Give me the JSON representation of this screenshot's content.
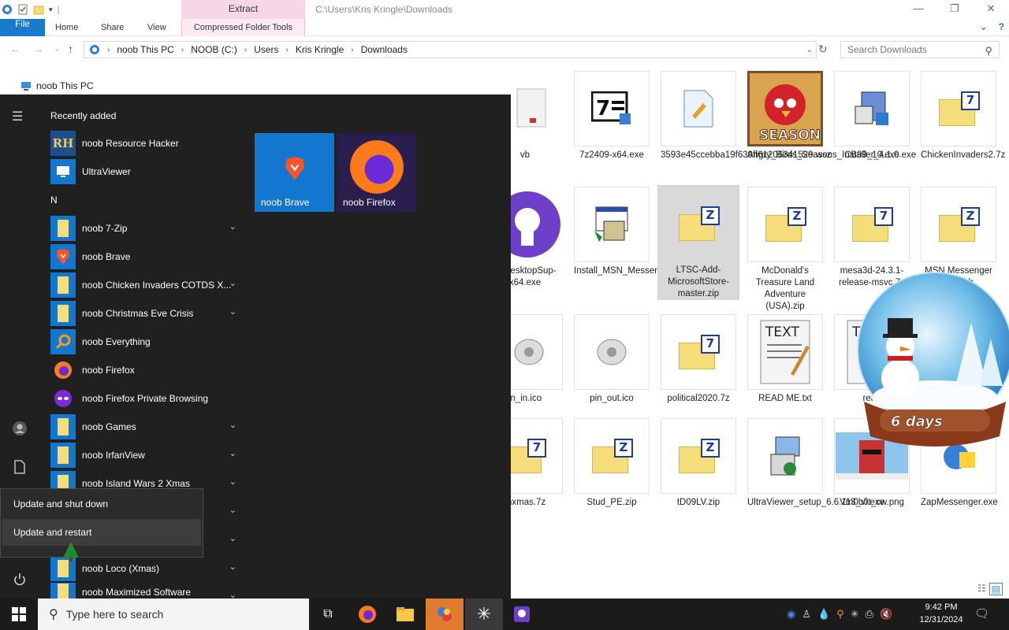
{
  "title_bar": {
    "context_tab": "Extract",
    "path": "C:\\Users\\Kris Kringle\\Downloads",
    "minimize": "—",
    "restore": "❐",
    "close": "✕"
  },
  "ribbon": {
    "tabs": [
      "File",
      "Home",
      "Share",
      "View"
    ],
    "context_tab": "Compressed Folder Tools"
  },
  "address": {
    "crumbs": [
      "noob This PC",
      "NOOB (C:)",
      "Users",
      "Kris Kringle",
      "Downloads"
    ],
    "search_placeholder": "Search Downloads"
  },
  "nav_pane": {
    "this_pc": "noob This PC"
  },
  "files": [
    {
      "name": "vb",
      "type": "folder"
    },
    {
      "name": "7z2409-x64.exe",
      "type": "7zip-installer"
    },
    {
      "name": "3593e45ccebba19f639ff61206341529.wsz",
      "type": "wsz"
    },
    {
      "name": "Angry_Birds_Seasons_Installer_4.1.0.exe",
      "type": "angry-birds"
    },
    {
      "name": "CB99_10.exe",
      "type": "installer"
    },
    {
      "name": "ChickenInvaders2.7z",
      "type": "7z-archive"
    },
    {
      "name": "ubDesktopSup-x64.exe",
      "type": "github"
    },
    {
      "name": "Install_MSN_Messenger.exe",
      "type": "installer"
    },
    {
      "name": "LTSC-Add-MicrosoftStore-master.zip",
      "type": "zip",
      "selected": true
    },
    {
      "name": "McDonald's Treasure Land Adventure (USA).zip",
      "type": "zip"
    },
    {
      "name": "mesa3d-24.3.1-release-msvc.7z",
      "type": "7z-archive"
    },
    {
      "name": "MSN Messenger English",
      "type": "zip"
    },
    {
      "name": "in_in.ico",
      "type": "ico"
    },
    {
      "name": "pin_out.ico",
      "type": "ico"
    },
    {
      "name": "political2020.7z",
      "type": "7z-archive"
    },
    {
      "name": "READ ME.txt",
      "type": "text"
    },
    {
      "name": "read",
      "type": "text"
    },
    {
      "name": "mxmas.7z",
      "type": "7z-archive"
    },
    {
      "name": "Stud_PE.zip",
      "type": "zip"
    },
    {
      "name": "tD09LV.zip",
      "type": "zip"
    },
    {
      "name": "UltraViewer_setup_6.6.113_vi.exe",
      "type": "installer"
    },
    {
      "name": "Vm0b0t_cw.png",
      "type": "image"
    },
    {
      "name": "ZapMessenger.exe",
      "type": "installer"
    }
  ],
  "start_menu": {
    "section_recent": "Recently added",
    "recent": [
      {
        "label": "noob Resource Hacker",
        "icon": "RH"
      },
      {
        "label": "UltraViewer",
        "icon": "ultraviewer-icon"
      }
    ],
    "letter": "N",
    "apps": [
      {
        "label": "noob 7-Zip",
        "expand": true
      },
      {
        "label": "noob Brave",
        "expand": false
      },
      {
        "label": "noob Chicken Invaders COTDS X...",
        "expand": true
      },
      {
        "label": "noob Christmas Eve Crisis",
        "expand": true
      },
      {
        "label": "noob Everything",
        "expand": false
      },
      {
        "label": "noob Firefox",
        "expand": false
      },
      {
        "label": "noob Firefox Private Browsing",
        "expand": false
      },
      {
        "label": "noob Games",
        "expand": true
      },
      {
        "label": "noob IrfanView",
        "expand": true
      },
      {
        "label": "noob Island Wars 2 Xmas",
        "expand": true
      },
      {
        "label": "",
        "expand": true
      },
      {
        "label": "",
        "expand": true
      },
      {
        "label": "noob Loco (Xmas)",
        "expand": true
      },
      {
        "label": "noob Maximized Software",
        "expand": true
      }
    ],
    "tiles": [
      {
        "label": "noob Brave",
        "color": "#1377cf"
      },
      {
        "label": "noob Firefox",
        "color": "#2a1e4f"
      }
    ],
    "power_menu": [
      "Update and shut down",
      "Update and restart"
    ]
  },
  "globe": {
    "days_label": "6 days"
  },
  "taskbar": {
    "search_placeholder": "Type here to search",
    "time": "9:42 PM",
    "date": "12/31/2024"
  },
  "colors": {
    "accent": "#1979ca",
    "start_bg": "#202020",
    "taskbar_bg": "#1b1b1b",
    "selection": "#d9d9d9"
  }
}
